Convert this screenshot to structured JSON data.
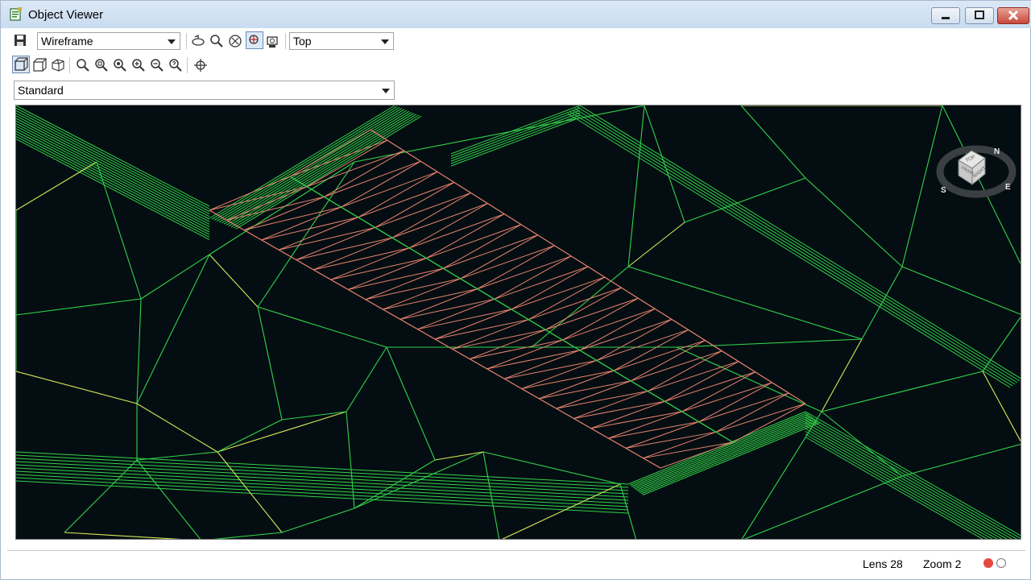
{
  "window": {
    "title": "Object Viewer"
  },
  "toolbar": {
    "visual_style": "Wireframe",
    "view_direction": "Top",
    "preset": "Standard"
  },
  "viewcube": {
    "top_label": "TOP",
    "right_label": "RIGHT",
    "front_label": "FRONT",
    "compass_n": "N",
    "compass_e": "E",
    "compass_s": "S"
  },
  "status": {
    "lens": "Lens 28",
    "zoom": "Zoom 2"
  },
  "colors": {
    "terrain": "#33d24a",
    "corridor": "#e8836e",
    "yellow": "#d9e85a",
    "background": "#040e12"
  }
}
